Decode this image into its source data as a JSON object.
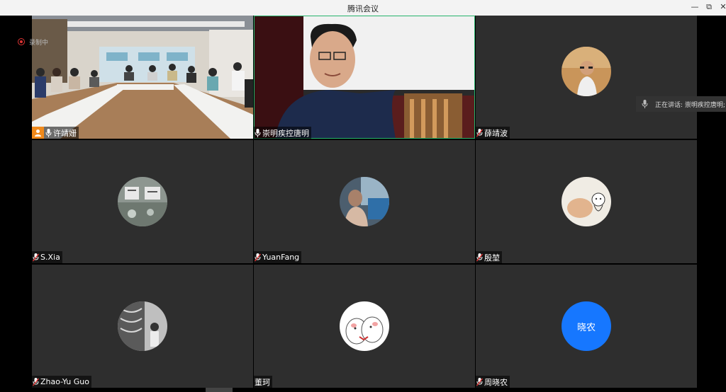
{
  "window": {
    "title": "腾讯会议",
    "minimize_icon": "—",
    "restore_icon": "⧉",
    "close_icon": "✕"
  },
  "recording": {
    "label": "录制中"
  },
  "speaking": {
    "label": "正在讲话: 崇明疾控唐明;"
  },
  "participants": [
    {
      "name": "许靖姗",
      "type": "video-room",
      "host": true
    },
    {
      "name": "崇明疾控唐明",
      "type": "video-person",
      "active": true
    },
    {
      "name": "薛靖波",
      "type": "photo-avatar"
    },
    {
      "name": "S.Xia",
      "type": "photo-avatar"
    },
    {
      "name": "YuanFang",
      "type": "photo-avatar"
    },
    {
      "name": "殷堃",
      "type": "photo-avatar"
    },
    {
      "name": "Zhao-Yu Guo",
      "type": "photo-avatar"
    },
    {
      "name": "董珂",
      "type": "photo-avatar"
    },
    {
      "name": "周晓农",
      "type": "text-avatar",
      "avatar_text": "晓农",
      "avatar_color": "#1677ff"
    }
  ],
  "colors": {
    "host_badge": "#f08a1c",
    "active_border": "#26b36b",
    "tile_bg": "#2e2e2e"
  }
}
